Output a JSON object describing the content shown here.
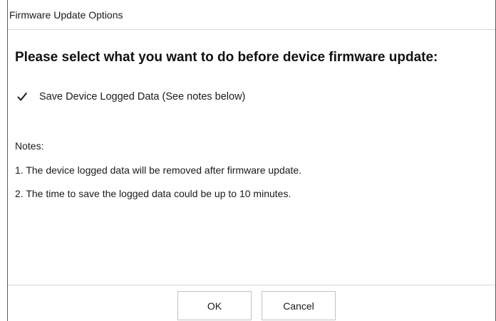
{
  "window": {
    "title": "Firmware Update Options"
  },
  "main": {
    "heading": "Please select what you want to do before device firmware update:",
    "options": [
      {
        "label": "Save Device Logged Data (See notes below)",
        "checked": true
      }
    ],
    "notes": {
      "title": "Notes:",
      "items": [
        "1. The device logged data will be removed after firmware update.",
        "2. The time to save the logged data could be up to 10 minutes."
      ]
    }
  },
  "footer": {
    "ok_label": "OK",
    "cancel_label": "Cancel"
  },
  "icons": {
    "checkbox": "checkmark-icon"
  }
}
